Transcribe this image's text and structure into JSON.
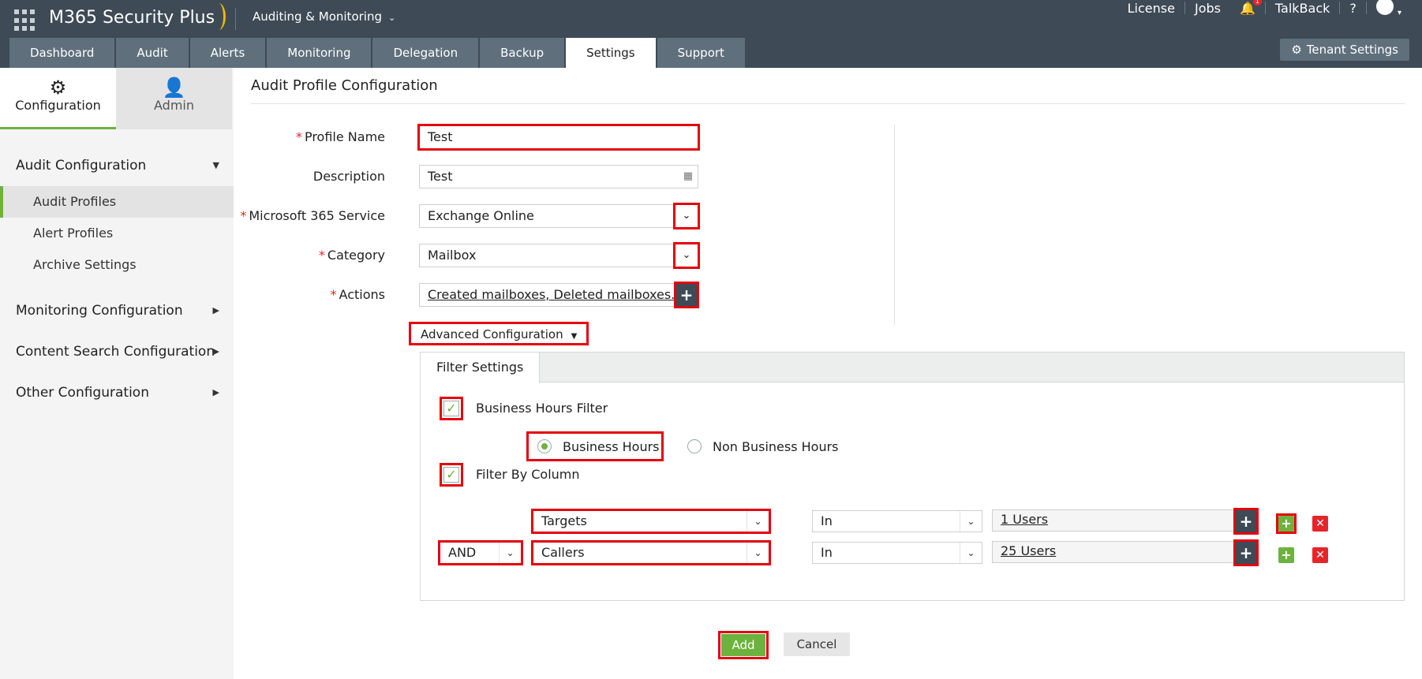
{
  "app": {
    "brand": "M365 Security Plus",
    "module": "Auditing & Monitoring",
    "top_links": {
      "license": "License",
      "jobs": "Jobs",
      "jobs_badge": "",
      "notif_badge": "1",
      "talkback": "TalkBack",
      "help": "?"
    }
  },
  "nav": {
    "tabs": [
      "Dashboard",
      "Audit",
      "Alerts",
      "Monitoring",
      "Delegation",
      "Backup",
      "Settings",
      "Support"
    ],
    "active": "Settings",
    "tenant_settings": "Tenant Settings"
  },
  "sidebar": {
    "tabs": {
      "configuration": "Configuration",
      "admin": "Admin"
    },
    "groups": {
      "audit": "Audit Configuration",
      "monitoring": "Monitoring Configuration",
      "content_search": "Content Search Configuration",
      "other": "Other Configuration"
    },
    "items": {
      "audit_profiles": "Audit Profiles",
      "alert_profiles": "Alert Profiles",
      "archive_settings": "Archive Settings"
    }
  },
  "page": {
    "title": "Audit Profile Configuration",
    "form": {
      "profile_name_label": "Profile Name",
      "profile_name_value": "Test",
      "description_label": "Description",
      "description_value": "Test",
      "service_label": "Microsoft 365 Service",
      "service_value": "Exchange Online",
      "category_label": "Category",
      "category_value": "Mailbox",
      "actions_label": "Actions",
      "actions_value": "Created mailboxes, Deleted mailboxes..."
    },
    "advanced": {
      "toggle_label": "Advanced Configuration",
      "filter_tab": "Filter Settings",
      "business_hours_filter": "Business Hours Filter",
      "business_hours": "Business Hours",
      "non_business_hours": "Non Business Hours",
      "filter_by_column": "Filter By Column",
      "rows": [
        {
          "column": "Targets",
          "operator": "In",
          "value": "1 Users"
        },
        {
          "logic": "AND",
          "column": "Callers",
          "operator": "In",
          "value": "25 Users"
        }
      ]
    },
    "buttons": {
      "add": "Add",
      "cancel": "Cancel"
    }
  },
  "colors": {
    "topbar": "#3e4a55",
    "accent_green": "#6cb33e",
    "highlight_red": "#e5000c"
  }
}
